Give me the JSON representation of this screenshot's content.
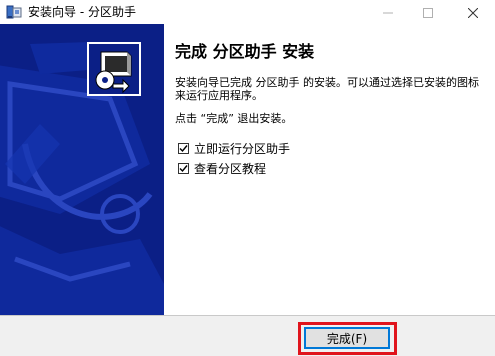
{
  "window": {
    "title": "安装向导 - 分区助手",
    "icon": "installer-app-icon"
  },
  "window_controls": {
    "minimize_icon": "minimize-icon",
    "maximize_icon": "maximize-icon",
    "close_icon": "close-icon"
  },
  "banner": {
    "icon": "installer-computer-icon",
    "background_color": "#0b1f86"
  },
  "content": {
    "heading": "完成 分区助手 安装",
    "description": "安装向导已完成 分区助手 的安装。可以通过选择已安装的图标来运行应用程序。",
    "hint": "点击 “完成” 退出安装。",
    "options": [
      {
        "label": "立即运行分区助手",
        "checked": true
      },
      {
        "label": "查看分区教程",
        "checked": true
      }
    ]
  },
  "footer": {
    "finish_label": "完成(F)",
    "highlight_color": "#e0141c"
  }
}
